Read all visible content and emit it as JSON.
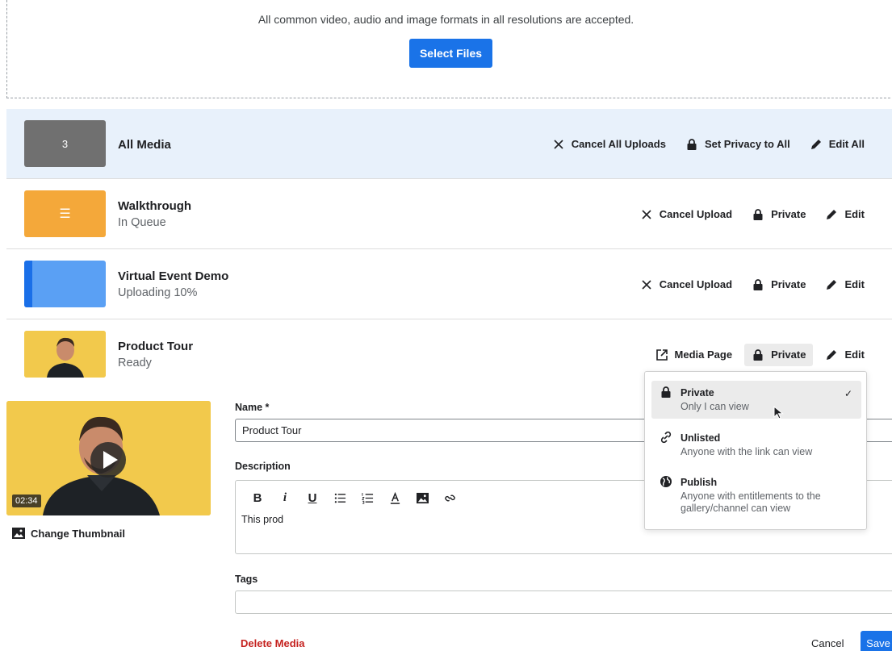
{
  "dropzone": {
    "hint": "All common video, audio and image formats in all resolutions are accepted.",
    "select_label": "Select Files"
  },
  "all_media": {
    "count": "3",
    "title": "All Media",
    "cancel_all": "Cancel All Uploads",
    "privacy_all": "Set Privacy to All",
    "edit_all": "Edit All"
  },
  "items": [
    {
      "title": "Walkthrough",
      "status": "In Queue",
      "cancel": "Cancel Upload",
      "privacy": "Private",
      "edit": "Edit"
    },
    {
      "title": "Virtual Event Demo",
      "status": "Uploading 10%",
      "progress": 0.1,
      "cancel": "Cancel Upload",
      "privacy": "Private",
      "edit": "Edit"
    },
    {
      "title": "Product Tour",
      "status": "Ready",
      "media_page": "Media Page",
      "privacy": "Private",
      "edit": "Edit"
    }
  ],
  "editor": {
    "duration": "02:34",
    "change_thumbnail": "Change Thumbnail",
    "name_label": "Name *",
    "name_value": "Product Tour",
    "description_label": "Description",
    "description_text": "This prod",
    "toolbar": [
      "B",
      "i",
      "U"
    ],
    "tags_label": "Tags",
    "delete": "Delete Media",
    "cancel": "Cancel",
    "save": "Save"
  },
  "privacy_menu": {
    "options": [
      {
        "title": "Private",
        "desc": "Only I can view",
        "icon": "lock-icon",
        "selected": true
      },
      {
        "title": "Unlisted",
        "desc": "Anyone with the link can view",
        "icon": "link-icon"
      },
      {
        "title": "Publish",
        "desc": "Anyone with entitlements to the gallery/channel can view",
        "icon": "globe-icon"
      }
    ],
    "check": "✓"
  },
  "colors": {
    "accent": "#1a73e8",
    "danger": "#c5221f",
    "all_row_bg": "#e8f1fb"
  }
}
